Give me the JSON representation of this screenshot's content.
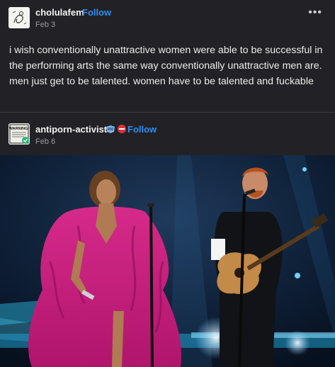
{
  "post1": {
    "username": "cholulafem",
    "follow_label": "Follow",
    "date": "Feb 3",
    "more_label": "•••",
    "text": "i wish conventionally unattractive women were able to be successful in the performing arts the same way conventionally unattractive men are. men just get to be talented. women have to be talented and fuckable"
  },
  "post2": {
    "username": "antiporn-activist",
    "follow_label": "Follow",
    "date": "Feb 6",
    "avatar_text": "WARNING!",
    "badges": [
      "badge-icon-blue",
      "no-entry-icon"
    ]
  }
}
